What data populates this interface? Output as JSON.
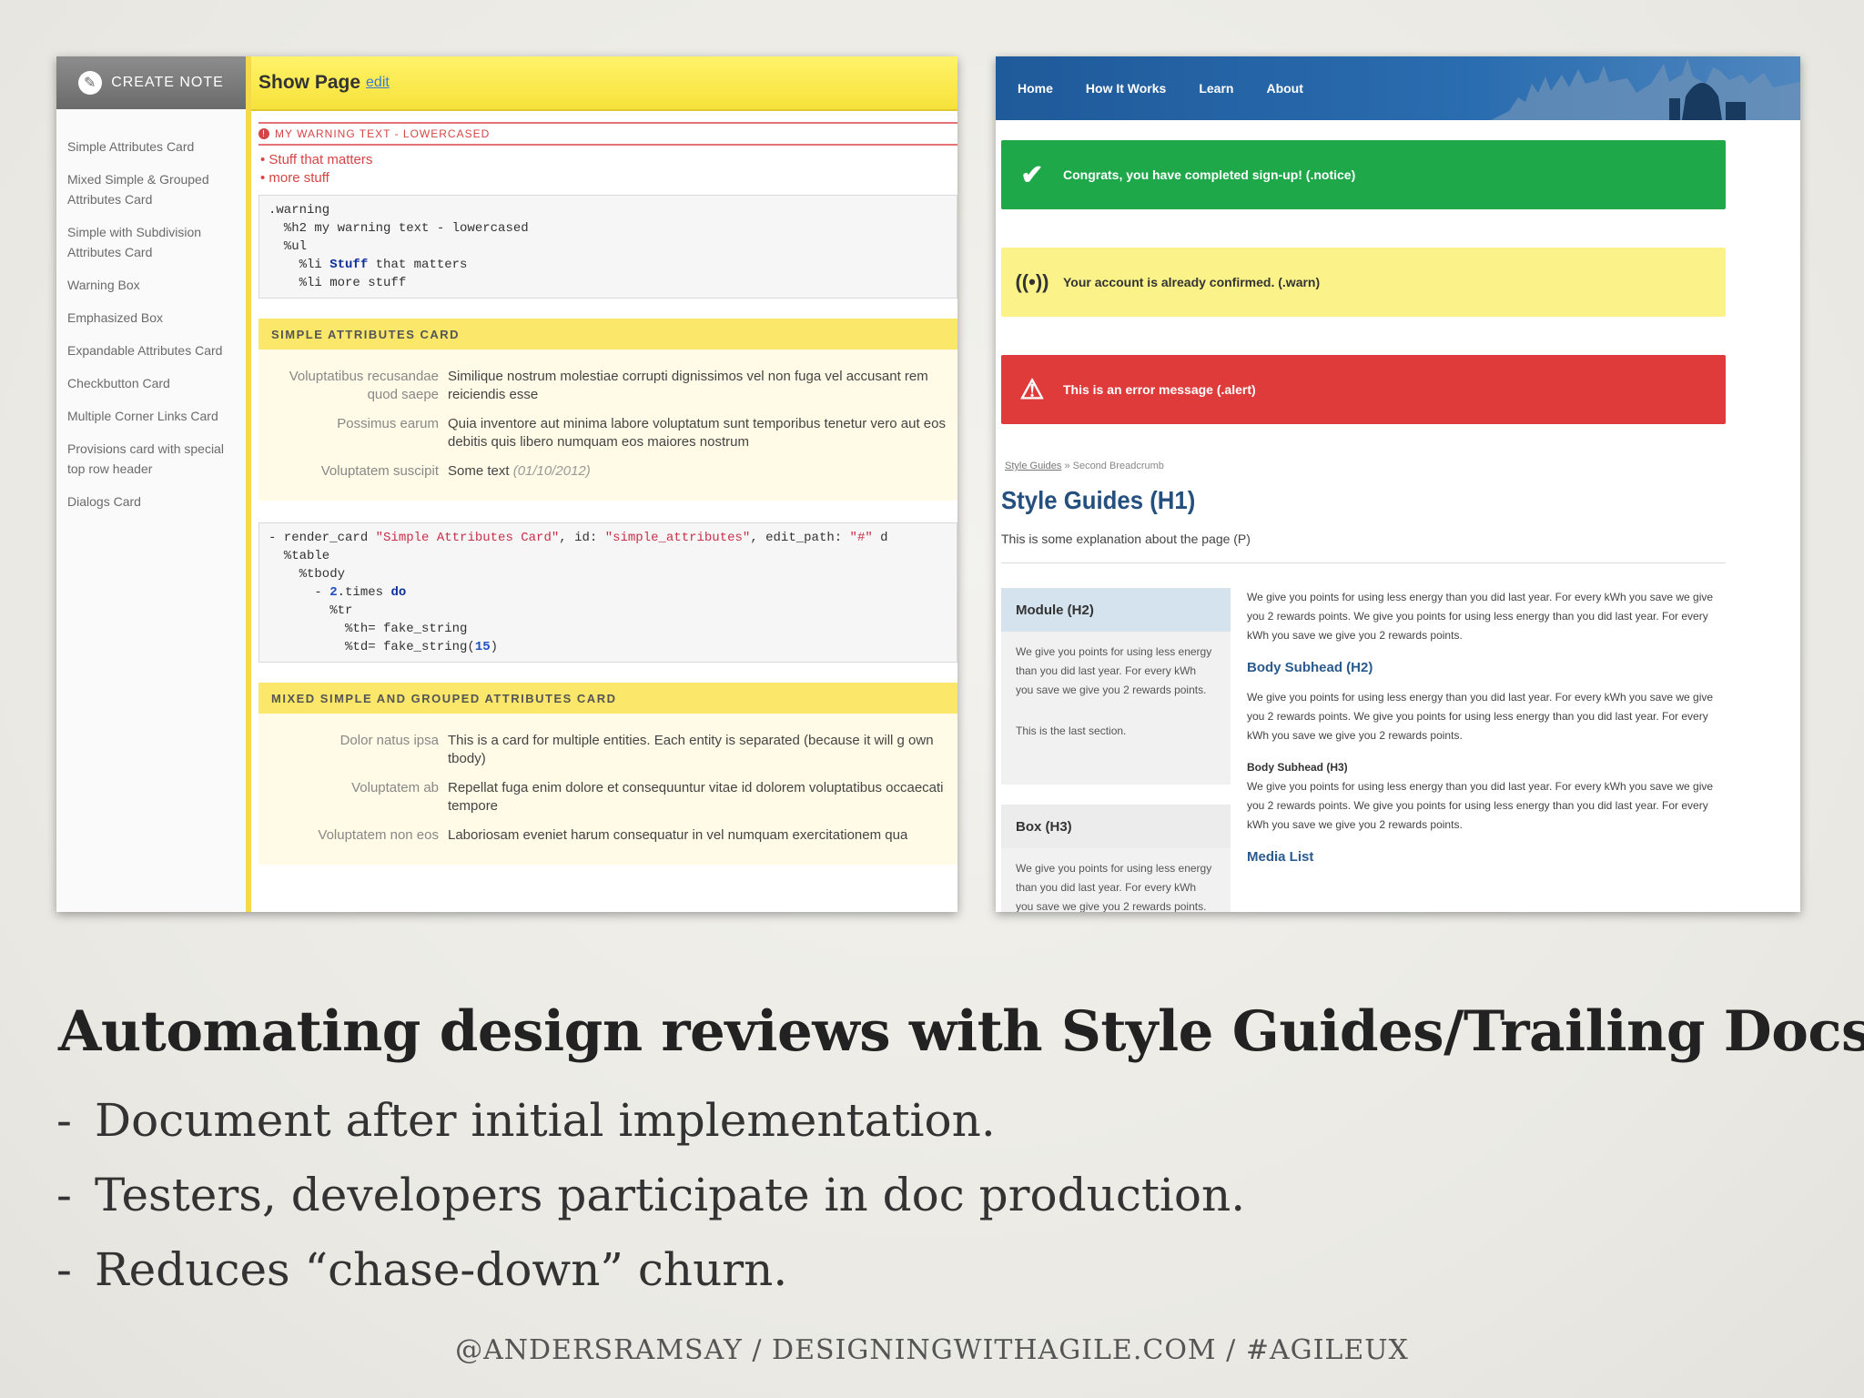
{
  "left_screenshot": {
    "create_note": "CREATE NOTE",
    "sidebar": [
      "Simple Attributes Card",
      "Mixed Simple & Grouped Attributes Card",
      "Simple with Subdivision Attributes Card",
      "Warning Box",
      "Emphasized Box",
      "Expandable Attributes Card",
      "Checkbutton Card",
      "Multiple Corner Links Card",
      "Provisions card with special top row header",
      "Dialogs Card"
    ],
    "header_title": "Show Page",
    "header_edit": "edit",
    "warning_title": "MY WARNING TEXT - LOWERCASED",
    "warning_items": [
      "Stuff that matters",
      "more stuff"
    ],
    "code1": [
      ".warning",
      "  %h2 my warning text - lowercased",
      "  %ul",
      "    %li ",
      "Stuff",
      " that matters",
      "    %li more stuff"
    ],
    "card1_title": "SIMPLE ATTRIBUTES CARD",
    "card1_rows": [
      {
        "label": "Voluptatibus recusandae quod saepe",
        "value": "Similique nostrum molestiae corrupti dignissimos vel non fuga vel accusant rem reiciendis esse"
      },
      {
        "label": "Possimus earum",
        "value": "Quia inventore aut minima labore voluptatum sunt temporibus tenetur vero aut eos debitis quis libero numquam eos maiores nostrum"
      },
      {
        "label": "Voluptatem suscipit",
        "value": "Some text",
        "date": "(01/10/2012)"
      }
    ],
    "code2": {
      "l1a": "- render_card ",
      "l1b": "\"Simple Attributes Card\"",
      "l1c": ", id: ",
      "l1d": "\"simple_attributes\"",
      "l1e": ", edit_path: ",
      "l1f": "\"#\"",
      "l1g": " d",
      "l2": "  %table",
      "l3": "    %tbody",
      "l4a": "      - ",
      "l4b": "2",
      "l4c": ".times ",
      "l4d": "do",
      "l5": "        %tr",
      "l6": "          %th= fake_string",
      "l7a": "          %td= fake_string(",
      "l7b": "15",
      "l7c": ")"
    },
    "card2_title": "MIXED SIMPLE AND GROUPED ATTRIBUTES CARD",
    "card2_rows": [
      {
        "label": "Dolor natus ipsa",
        "value": "This is a card for multiple entities. Each entity is separated (because it will g own tbody)"
      },
      {
        "label": "Voluptatem ab",
        "value": "Repellat fuga enim dolore et consequuntur vitae id dolorem voluptatibus occaecati tempore"
      },
      {
        "label": "Voluptatem non eos",
        "value": "Laboriosam eveniet harum consequatur in vel numquam exercitationem qua"
      }
    ]
  },
  "right_screenshot": {
    "nav": [
      "Home",
      "How It Works",
      "Learn",
      "About"
    ],
    "alert_success": "Congrats, you have completed sign-up! (.notice)",
    "alert_warn": "Your account is already confirmed. (.warn)",
    "alert_error": "This is an error message (.alert)",
    "breadcrumb_link": "Style Guides",
    "breadcrumb_current": "» Second Breadcrumb",
    "h1": "Style Guides (H1)",
    "intro": "This is some explanation about the page (P)",
    "module_title": "Module (H2)",
    "module_text": "We give you points for using less energy than you did last year. For every kWh you save we give you 2 rewards points.",
    "module_last": "This is the last section.",
    "box_title": "Box (H3)",
    "box_text": "We give you points for using less energy than you did last year. For every kWh you save we give you 2 rewards points.",
    "body_para": "We give you points for using less energy than you did last year. For every kWh you save we give you 2 rewards points. We give you points for using less energy than you did last year. For every kWh you save we give you 2 rewards points.",
    "body_subhead_h2": "Body Subhead (H2)",
    "body_subhead_h3": "Body Subhead (H3)",
    "media_list": "Media List"
  },
  "slide": {
    "title": "Automating design reviews with Style Guides/Trailing Docs",
    "bullets": [
      "Document after initial implementation.",
      "Testers, developers participate in doc production.",
      "Reduces “chase-down” churn."
    ],
    "bullet_marker": "-",
    "footer": "@ANDERSRAMSAY  /  DESIGNINGWITHAGILE.COM  /  #AGILEUX"
  }
}
